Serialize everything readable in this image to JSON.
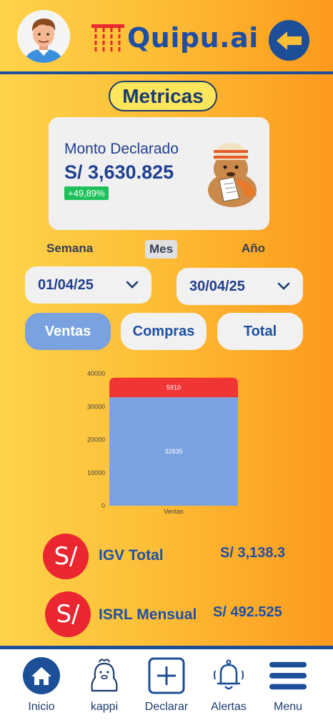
{
  "header": {
    "logo_text": "Quipu.ai"
  },
  "metrics": {
    "title": "Metricas"
  },
  "card": {
    "label": "Monto Declarado",
    "amount": "S/ 3,630.825",
    "badge": "+49,89%"
  },
  "periods": {
    "semana": "Semana",
    "mes": "Mes",
    "anio": "Año",
    "selected": "Mes"
  },
  "dates": {
    "start": "01/04/25",
    "end": "30/04/25"
  },
  "segments": {
    "ventas": "Ventas",
    "compras": "Compras",
    "total": "Total",
    "selected": "Ventas"
  },
  "chart_data": {
    "type": "bar",
    "stacked": true,
    "categories": [
      "Ventas"
    ],
    "series": [
      {
        "values": [
          32835
        ],
        "color": "#7aa2e0"
      },
      {
        "values": [
          5910
        ],
        "color": "#f03535"
      }
    ],
    "ylim": [
      0,
      40000
    ],
    "yticks": [
      "0",
      "10000",
      "20000",
      "30000",
      "40000"
    ],
    "grid": false
  },
  "taxes": [
    {
      "icon_text": "S/",
      "label": "IGV Total",
      "value": "S/ 3,138.3"
    },
    {
      "icon_text": "S/",
      "label": "ISRL Mensual",
      "value": "S/ 492.525"
    }
  ],
  "nav": {
    "inicio": "Inicio",
    "kappi": "kappi",
    "declarar": "Declarar",
    "alertas": "Alertas",
    "menu": "Menu"
  },
  "colors": {
    "primary": "#1c4f97",
    "accent_yellow": "#fdd34a",
    "accent_orange": "#fd9a1d",
    "positive": "#1ec05a",
    "danger": "#ea2730"
  }
}
